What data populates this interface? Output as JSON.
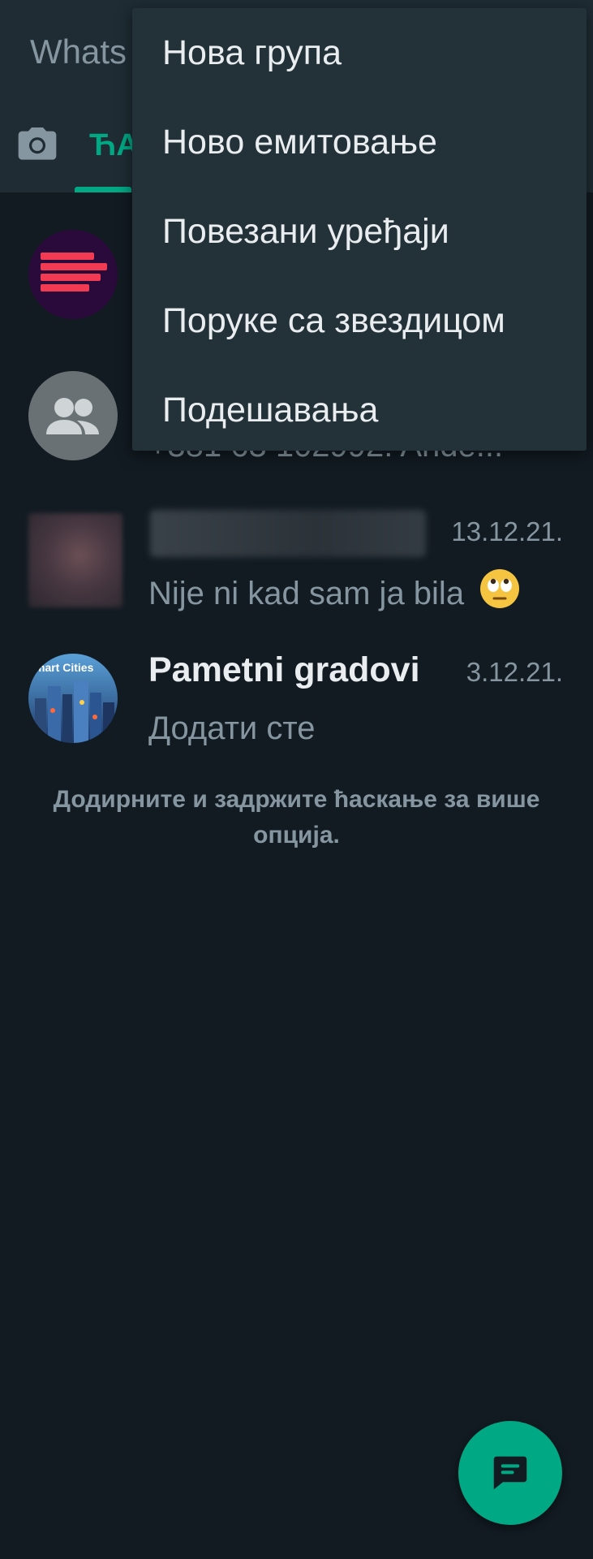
{
  "header": {
    "app_title": "Whats",
    "tabs": [
      {
        "icon": "camera-icon"
      },
      {
        "label": "ЋА"
      }
    ]
  },
  "chats": [
    {
      "avatar": "news-avatar-icon"
    },
    {
      "avatar": "group-avatar-icon",
      "preview": "+381 63 102992: Ande..."
    },
    {
      "name": "",
      "date": "13.12.21.",
      "preview": "Nije ni kad sam ja bila",
      "emoji": "🙄"
    },
    {
      "name": "Pametni gradovi",
      "date": "3.12.21.",
      "preview": "Додати сте",
      "avatar_label": "mart Cities"
    }
  ],
  "hint": "Додирните и задржите ћаскање за више опција.",
  "menu": {
    "items": [
      {
        "label": "Нова група"
      },
      {
        "label": "Ново емитовање"
      },
      {
        "label": "Повезани уређаји"
      },
      {
        "label": "Поруке са звездицом"
      },
      {
        "label": "Подешавања"
      }
    ]
  },
  "fab": {
    "icon": "new-chat-icon"
  },
  "colors": {
    "background": "#121b22",
    "header": "#1f2c34",
    "menu": "#233138",
    "accent": "#00a884",
    "secondary_text": "#8696a0",
    "primary_text": "#e9edef"
  }
}
